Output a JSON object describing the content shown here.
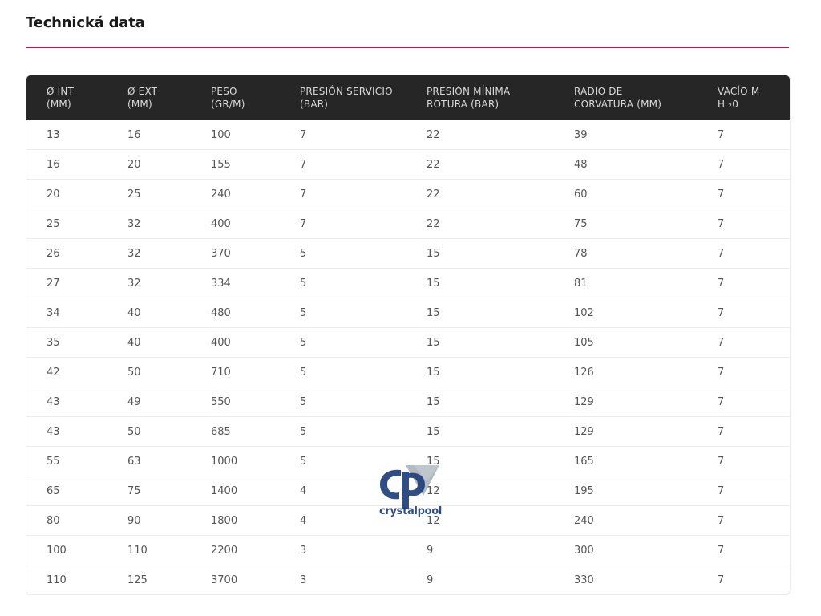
{
  "page": {
    "title": "Technická data",
    "accent_color": "#b01e4f",
    "header_bg": "#262626"
  },
  "table": {
    "headers": [
      [
        "Ø INT",
        "(MM)"
      ],
      [
        "Ø EXT",
        "(MM)"
      ],
      [
        "PESO",
        "(GR/M)"
      ],
      [
        "PRESIÓN SERVICIO",
        "(BAR)"
      ],
      [
        "PRESIÓN MÍNIMA",
        "ROTURA (BAR)"
      ],
      [
        "RADIO DE",
        "CORVATURA (MM)"
      ],
      [
        "VACÍO M",
        "H ₂0"
      ]
    ],
    "rows": [
      [
        "13",
        "16",
        "100",
        "7",
        "22",
        "39",
        "7"
      ],
      [
        "16",
        "20",
        "155",
        "7",
        "22",
        "48",
        "7"
      ],
      [
        "20",
        "25",
        "240",
        "7",
        "22",
        "60",
        "7"
      ],
      [
        "25",
        "32",
        "400",
        "7",
        "22",
        "75",
        "7"
      ],
      [
        "26",
        "32",
        "370",
        "5",
        "15",
        "78",
        "7"
      ],
      [
        "27",
        "32",
        "334",
        "5",
        "15",
        "81",
        "7"
      ],
      [
        "34",
        "40",
        "480",
        "5",
        "15",
        "102",
        "7"
      ],
      [
        "35",
        "40",
        "400",
        "5",
        "15",
        "105",
        "7"
      ],
      [
        "42",
        "50",
        "710",
        "5",
        "15",
        "126",
        "7"
      ],
      [
        "43",
        "49",
        "550",
        "5",
        "15",
        "129",
        "7"
      ],
      [
        "43",
        "50",
        "685",
        "5",
        "15",
        "129",
        "7"
      ],
      [
        "55",
        "63",
        "1000",
        "5",
        "15",
        "165",
        "7"
      ],
      [
        "65",
        "75",
        "1400",
        "4",
        "12",
        "195",
        "7"
      ],
      [
        "80",
        "90",
        "1800",
        "4",
        "12",
        "240",
        "7"
      ],
      [
        "100",
        "110",
        "2200",
        "3",
        "9",
        "300",
        "7"
      ],
      [
        "110",
        "125",
        "3700",
        "3",
        "9",
        "330",
        "7"
      ]
    ]
  },
  "watermark": {
    "text": "crystalpool",
    "mark": "cp",
    "icon": "crystalpool-logo-icon",
    "color": "#1f3f7a"
  }
}
